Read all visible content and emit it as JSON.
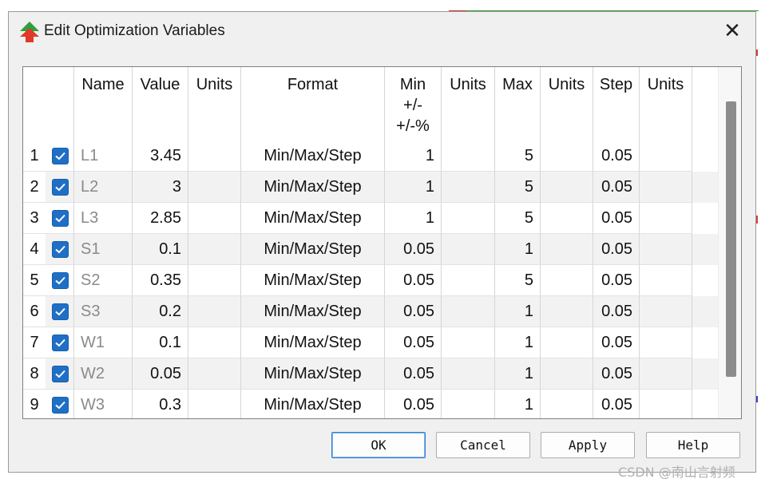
{
  "window": {
    "title": "Edit Optimization Variables",
    "close_glyph": "✕"
  },
  "columns": {
    "name": "Name",
    "value": "Value",
    "units1": "Units",
    "format": "Format",
    "min_lines": [
      "Min",
      "+/-",
      "+/-%"
    ],
    "units2": "Units",
    "max": "Max",
    "units3": "Units",
    "step": "Step",
    "units4": "Units"
  },
  "rows": [
    {
      "index": "1",
      "checked": true,
      "name": "L1",
      "value": "3.45",
      "format": "Min/Max/Step",
      "min": "1",
      "max": "5",
      "step": "0.05"
    },
    {
      "index": "2",
      "checked": true,
      "name": "L2",
      "value": "3",
      "format": "Min/Max/Step",
      "min": "1",
      "max": "5",
      "step": "0.05"
    },
    {
      "index": "3",
      "checked": true,
      "name": "L3",
      "value": "2.85",
      "format": "Min/Max/Step",
      "min": "1",
      "max": "5",
      "step": "0.05"
    },
    {
      "index": "4",
      "checked": true,
      "name": "S1",
      "value": "0.1",
      "format": "Min/Max/Step",
      "min": "0.05",
      "max": "1",
      "step": "0.05"
    },
    {
      "index": "5",
      "checked": true,
      "name": "S2",
      "value": "0.35",
      "format": "Min/Max/Step",
      "min": "0.05",
      "max": "5",
      "step": "0.05"
    },
    {
      "index": "6",
      "checked": true,
      "name": "S3",
      "value": "0.2",
      "format": "Min/Max/Step",
      "min": "0.05",
      "max": "1",
      "step": "0.05"
    },
    {
      "index": "7",
      "checked": true,
      "name": "W1",
      "value": "0.1",
      "format": "Min/Max/Step",
      "min": "0.05",
      "max": "1",
      "step": "0.05"
    },
    {
      "index": "8",
      "checked": true,
      "name": "W2",
      "value": "0.05",
      "format": "Min/Max/Step",
      "min": "0.05",
      "max": "1",
      "step": "0.05"
    },
    {
      "index": "9",
      "checked": true,
      "name": "W3",
      "value": "0.3",
      "format": "Min/Max/Step",
      "min": "0.05",
      "max": "1",
      "step": "0.05"
    }
  ],
  "buttons": {
    "ok": "OK",
    "cancel": "Cancel",
    "apply": "Apply",
    "help": "Help"
  },
  "watermark": "CSDN @南山言射频",
  "colors": {
    "checkbox": "#1f6fc7",
    "name_text": "#8a8a8a",
    "default_button_border": "#2a7fd4"
  }
}
